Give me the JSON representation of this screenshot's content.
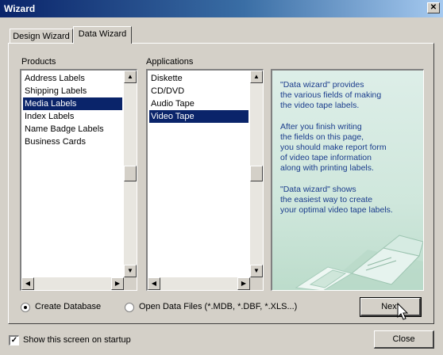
{
  "window": {
    "title": "Wizard"
  },
  "tabs": [
    {
      "label": "Design Wizard",
      "active": false
    },
    {
      "label": "Data Wizard",
      "active": true
    }
  ],
  "products": {
    "label": "Products",
    "items": [
      "Address Labels",
      "Shipping Labels",
      "Media Labels",
      "Index Labels",
      "Name Badge Labels",
      "Business Cards"
    ],
    "selected": "Media Labels"
  },
  "applications": {
    "label": "Applications",
    "items": [
      "Diskette",
      "CD/DVD",
      "Audio Tape",
      "Video Tape"
    ],
    "selected": "Video Tape"
  },
  "info": {
    "p1": "\"Data wizard\" provides\nthe various fields of making\nthe video tape labels.",
    "p2": "After you finish writing\nthe fields on this page,\nyou should make report form\nof video tape information\nalong with printing labels.",
    "p3": "\"Data wizard\" shows\nthe easiest way to create\nyour optimal video tape labels."
  },
  "options": {
    "create_db": {
      "label": "Create Database",
      "checked": true
    },
    "open_files": {
      "label": "Open Data Files (*.MDB, *.DBF, *.XLS...)",
      "checked": false
    }
  },
  "buttons": {
    "next": "Next",
    "close": "Close"
  },
  "startup": {
    "label": "Show this screen on startup",
    "checked": true
  },
  "colors": {
    "selection": "#0a246a",
    "info_text": "#1a3c8c",
    "face": "#d4d0c8"
  }
}
